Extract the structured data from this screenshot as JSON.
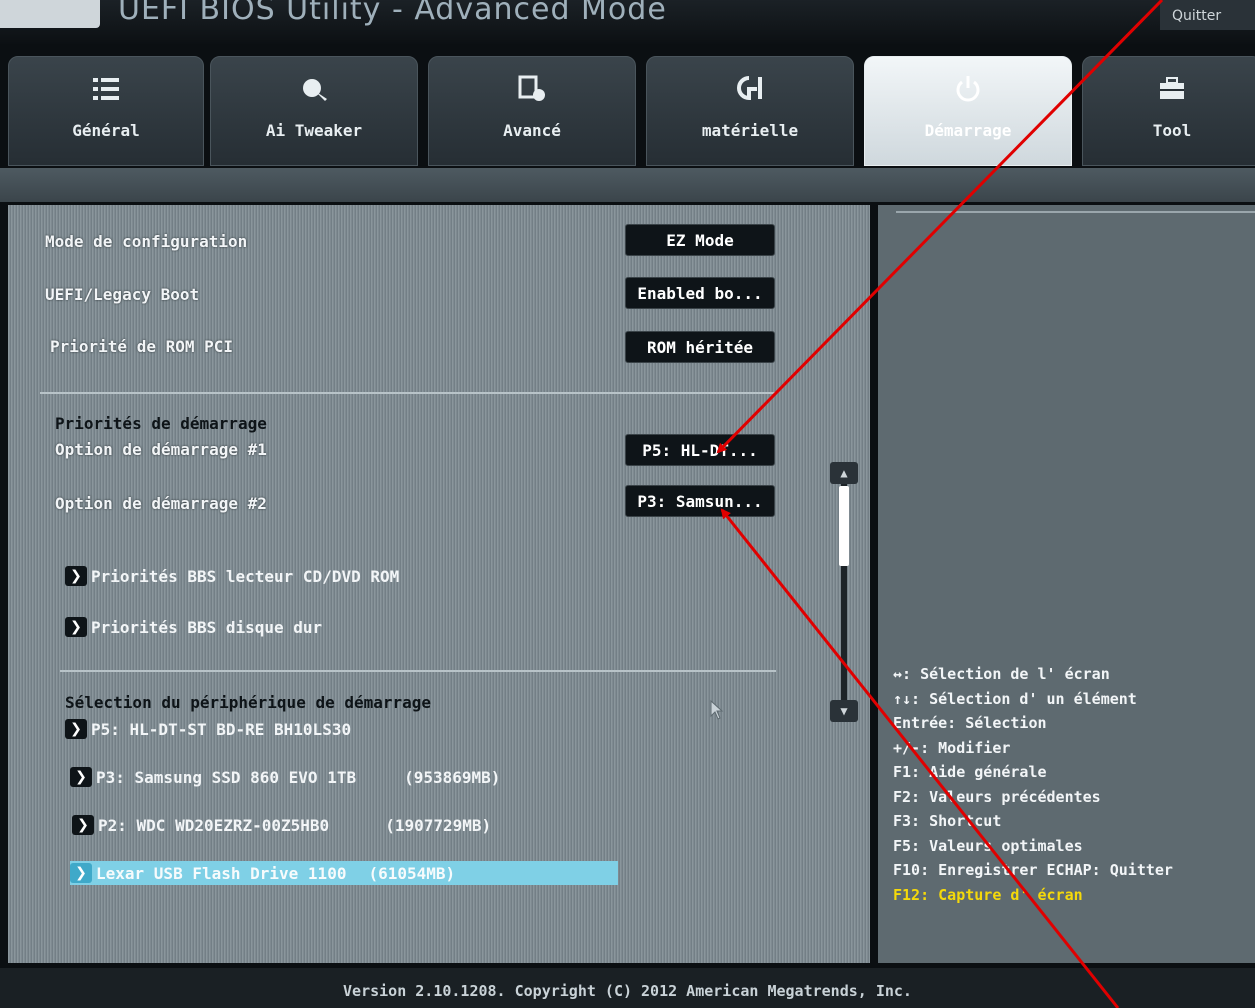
{
  "title": {
    "text": "UEFI BIOS Utility - Advanced Mode",
    "exit_label": "Quitter"
  },
  "tabs": [
    {
      "label": "Général",
      "icon": "list-icon",
      "active": false
    },
    {
      "label": "Ai Tweaker",
      "icon": "tweaker-icon",
      "active": false
    },
    {
      "label": "Avancé",
      "icon": "advanced-icon",
      "active": false
    },
    {
      "label": "matérielle",
      "icon": "monitor-icon",
      "active": false
    },
    {
      "label": "Démarrage",
      "icon": "power-icon",
      "active": true
    },
    {
      "label": "Tool",
      "icon": "toolbox-icon",
      "active": false
    }
  ],
  "settings": {
    "config_mode": {
      "label": "Mode de configuration",
      "value": "EZ Mode"
    },
    "uefi_boot": {
      "label": "UEFI/Legacy Boot",
      "value": "Enabled bo..."
    },
    "pci_rom": {
      "label": "Priorité de ROM PCI",
      "value": "ROM héritée"
    }
  },
  "boot_priorities": {
    "heading": "Priorités de démarrage",
    "option1": {
      "label": "Option de démarrage #1",
      "value": "P5: HL-DT..."
    },
    "option2": {
      "label": "Option de démarrage #2",
      "value": "P3: Samsun..."
    }
  },
  "bbs_links": {
    "cdrom": "Priorités BBS lecteur CD/DVD ROM",
    "hdd": "Priorités BBS disque dur"
  },
  "device_selection": {
    "heading": "Sélection du périphérique de démarrage",
    "devices": [
      {
        "name": "P5: HL-DT-ST BD-RE  BH10LS30",
        "size": ""
      },
      {
        "name": "P3: Samsung SSD 860 EVO 1TB",
        "size": "(953869MB)"
      },
      {
        "name": "P2: WDC WD20EZRZ-00Z5HB0",
        "size": "(1907729MB)"
      },
      {
        "name": "Lexar USB Flash Drive 1100",
        "size": "(61054MB)"
      }
    ],
    "selected_index": 3
  },
  "help": [
    {
      "text": "↔: Sélection de l' écran",
      "highlight": false
    },
    {
      "text": "↑↓: Sélection d' un élément",
      "highlight": false
    },
    {
      "text": "Entrée: Sélection",
      "highlight": false
    },
    {
      "text": "+/-: Modifier",
      "highlight": false
    },
    {
      "text": "F1: Aide générale",
      "highlight": false
    },
    {
      "text": "F2: Valeurs précédentes",
      "highlight": false
    },
    {
      "text": "F3: Shortcut",
      "highlight": false
    },
    {
      "text": "F5: Valeurs optimales",
      "highlight": false
    },
    {
      "text": "F10: Enregistrer  ECHAP: Quitter",
      "highlight": false
    },
    {
      "text": "F12: Capture d' écran",
      "highlight": true
    }
  ],
  "footer": {
    "text": "Version 2.10.1208. Copyright (C) 2012 American Megatrends, Inc."
  },
  "colors": {
    "annotation": "#e00000",
    "highlight": "#f5d90a",
    "selection": "#7fd0e6"
  }
}
